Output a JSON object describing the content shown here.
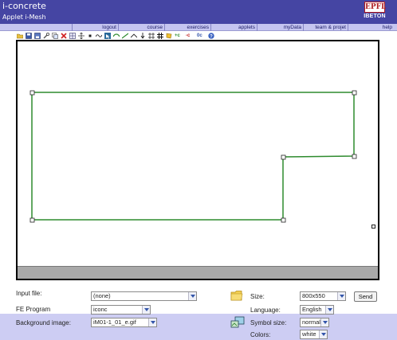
{
  "header": {
    "app_title": "i-concrete",
    "app_subtitle": "Applet i-Mesh",
    "logo_glyph": "EPFL",
    "logo_text": "IBETON",
    "bg_color": "#4545a3"
  },
  "nav": {
    "items": [
      {
        "label": "logout"
      },
      {
        "label": "course"
      },
      {
        "label": "exercises"
      },
      {
        "label": "applets"
      },
      {
        "label": "myData"
      },
      {
        "label": "team & projet"
      },
      {
        "label": "help"
      }
    ],
    "bg_color": "#c5c5f0"
  },
  "toolbar": {
    "tools": [
      {
        "icon": "open-folder-icon"
      },
      {
        "icon": "save-icon"
      },
      {
        "icon": "save-as-icon"
      },
      {
        "icon": "wrench-icon"
      },
      {
        "icon": "copy-icon"
      },
      {
        "icon": "delete-icon"
      },
      {
        "icon": "grid-icon"
      },
      {
        "icon": "move-icon"
      },
      {
        "icon": "point-icon"
      },
      {
        "icon": "curve-icon"
      },
      {
        "icon": "select-icon"
      },
      {
        "icon": "spline-icon"
      },
      {
        "icon": "line-icon"
      },
      {
        "icon": "angle-icon"
      },
      {
        "icon": "arrow-down-icon"
      },
      {
        "icon": "split-icon"
      },
      {
        "icon": "hash-icon"
      },
      {
        "icon": "shape-icon"
      },
      {
        "icon": "plus-c-icon"
      },
      {
        "icon": "minus-c-icon"
      },
      {
        "icon": "zero-c-icon"
      },
      {
        "icon": "help-icon"
      }
    ],
    "plus_c": "+c",
    "minus_c": "-c",
    "zero_c": "0c"
  },
  "canvas": {
    "shape_color": "#2e8b2e"
  },
  "form": {
    "input_file": {
      "label": "Input file:",
      "value": "(none)"
    },
    "fe_program": {
      "label": "FE Program",
      "value": "iconc"
    },
    "background_image": {
      "label": "Background image:",
      "value": "iM01-1_01_e.gif"
    },
    "size": {
      "label": "Size:",
      "value": "800x550"
    },
    "language": {
      "label": "Language:",
      "value": "English"
    },
    "symbol_size": {
      "label": "Symbol size:",
      "value": "normal"
    },
    "colors": {
      "label": "Colors:",
      "value": "white"
    },
    "send_label": "Send",
    "lower_bg": "#cdcdf3"
  }
}
